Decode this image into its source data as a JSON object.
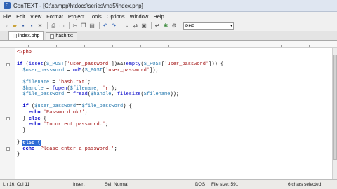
{
  "window": {
    "title": "ConTEXT - [C:\\xampp\\htdocs\\series\\md5\\index.php]",
    "app_icon": "context-app-icon"
  },
  "menu": [
    "File",
    "Edit",
    "View",
    "Format",
    "Project",
    "Tools",
    "Options",
    "Window",
    "Help"
  ],
  "toolbar": {
    "language": "PHP"
  },
  "tabs": [
    {
      "label": "index.php",
      "active": true
    },
    {
      "label": "hash.txt",
      "active": false
    }
  ],
  "code_lines": [
    "<?php",
    "",
    "if (isset($_POST['user_password'])&&!empty($_POST['user_password'])) {",
    "  $user_password = md5($_POST['user_password']);",
    "",
    "  $filename = 'hash.txt';",
    "  $handle = fopen($filename, 'r');",
    "  $file_password = fread($handle, filesize($filename));",
    "",
    "  if ($user_password==$file_password) {",
    "    echo 'Password ok!';",
    "  } else {",
    "    echo 'Incorrect password.';",
    "  }",
    "",
    "} else {",
    "  echo 'Please enter a password.';",
    "}"
  ],
  "status": {
    "position": "Ln 16, Col 11",
    "mode": "Insert",
    "selection": "Sel: Normal",
    "format": "DOS",
    "file_size": "File size: 591",
    "selected": "6 chars selected"
  }
}
